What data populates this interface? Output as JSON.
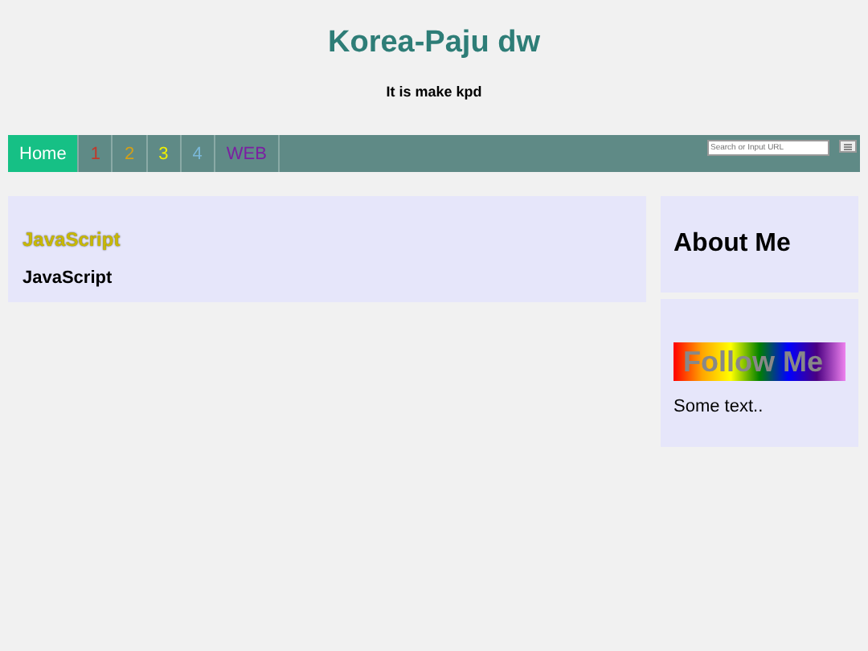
{
  "header": {
    "title": "Korea-Paju dw",
    "subtitle": "It is make kpd"
  },
  "nav": {
    "items": [
      {
        "label": "Home",
        "selected": true
      },
      {
        "label": "1",
        "selected": false
      },
      {
        "label": "2",
        "selected": false
      },
      {
        "label": "3",
        "selected": false
      },
      {
        "label": "4",
        "selected": false
      },
      {
        "label": "WEB",
        "selected": false
      }
    ],
    "search": {
      "placeholder": "Search or Input URL"
    }
  },
  "main_card": {
    "heading": "JavaScript",
    "text": "JavaScript"
  },
  "sidebar": {
    "about_title": "About Me",
    "follow_label": "Follow Me",
    "text": "Some text.."
  }
}
